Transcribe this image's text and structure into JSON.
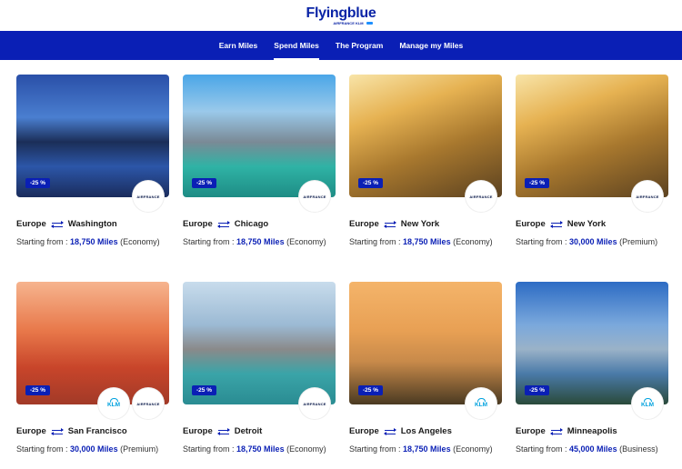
{
  "brand": {
    "logo_text": "Flyingblue",
    "logo_sub": "AIRFRANCE KLM"
  },
  "nav": {
    "items": [
      {
        "label": "Earn Miles",
        "active": false
      },
      {
        "label": "Spend Miles",
        "active": true
      },
      {
        "label": "The Program",
        "active": false
      },
      {
        "label": "Manage my Miles",
        "active": false
      }
    ]
  },
  "price_prefix": "Starting from : ",
  "offers": [
    {
      "origin": "Europe",
      "destination": "Washington",
      "miles": "18,750 Miles",
      "cabin": "(Economy)",
      "discount": "-25 %",
      "airlines": [
        "AIRFRANCE"
      ],
      "photo": "washington"
    },
    {
      "origin": "Europe",
      "destination": "Chicago",
      "miles": "18,750 Miles",
      "cabin": "(Economy)",
      "discount": "-25 %",
      "airlines": [
        "AIRFRANCE"
      ],
      "photo": "chicago"
    },
    {
      "origin": "Europe",
      "destination": "New York",
      "miles": "18,750 Miles",
      "cabin": "(Economy)",
      "discount": "-25 %",
      "airlines": [
        "AIRFRANCE"
      ],
      "photo": "ny"
    },
    {
      "origin": "Europe",
      "destination": "New York",
      "miles": "30,000 Miles",
      "cabin": "(Premium)",
      "discount": "-25 %",
      "airlines": [
        "AIRFRANCE"
      ],
      "photo": "ny"
    },
    {
      "origin": "Europe",
      "destination": "San Francisco",
      "miles": "30,000 Miles",
      "cabin": "(Premium)",
      "discount": "-25 %",
      "airlines": [
        "KLM",
        "AIRFRANCE"
      ],
      "photo": "sf"
    },
    {
      "origin": "Europe",
      "destination": "Detroit",
      "miles": "18,750 Miles",
      "cabin": "(Economy)",
      "discount": "-25 %",
      "airlines": [
        "AIRFRANCE"
      ],
      "photo": "detroit"
    },
    {
      "origin": "Europe",
      "destination": "Los Angeles",
      "miles": "18,750 Miles",
      "cabin": "(Economy)",
      "discount": "-25 %",
      "airlines": [
        "KLM"
      ],
      "photo": "la"
    },
    {
      "origin": "Europe",
      "destination": "Minneapolis",
      "miles": "45,000 Miles",
      "cabin": "(Business)",
      "discount": "-25 %",
      "airlines": [
        "KLM"
      ],
      "photo": "minneapolis"
    }
  ],
  "colors": {
    "brand_blue": "#0a1fb5",
    "klm_blue": "#00a1de"
  },
  "icons": {
    "route_swap": "swap-arrows-icon"
  }
}
